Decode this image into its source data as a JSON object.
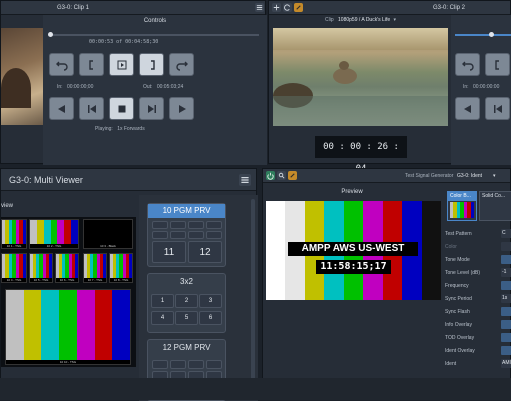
{
  "clip1": {
    "title": "G3-0: Clip 1",
    "controls_title": "Controls",
    "timecode": "00:00:53 of 00:04:58;30",
    "in_label": "In:",
    "in_value": "00:00:00;00",
    "out_label": "Out:",
    "out_value": "00:05:03;24",
    "playing_label": "Playing:",
    "playing_value": "1x Forwards"
  },
  "clip2": {
    "title": "G3-0: Clip 2",
    "clip_label": "Clip",
    "clip_value": "1080p59 / A Duck's Life",
    "timecode_big": "00 : 00 : 26 : 04",
    "in_label": "In:",
    "in_value": "00:00:00:00"
  },
  "multiviewer": {
    "title": "G3-0: Multi Viewer",
    "preview_label": "view",
    "layout1": {
      "title": "10 PGM PRV",
      "cells": [
        "",
        "",
        "",
        "",
        "",
        "",
        "",
        "",
        "",
        "11",
        "12"
      ]
    },
    "layout2": {
      "title": "3x2",
      "cells": [
        "1",
        "2",
        "3",
        "4",
        "5",
        "6"
      ]
    },
    "layout3": {
      "title": "12 PGM PRV"
    },
    "thumb_labels": [
      "10 1 - TSG",
      "10 2 - TSG",
      "10 3 - Black",
      "10 4 - TSG",
      "10 5 - TSG",
      "10 6 - TSG",
      "10 7 - TSG",
      "10 8 - TSG",
      "10 9 - TSG",
      "10 10 - TSG"
    ]
  },
  "tsg": {
    "gen_label": "Test Signal Generator",
    "gen_value": "G3-0: Ident",
    "preview_title": "Preview",
    "overlay_line1": "AMPP AWS US-WEST",
    "overlay_line2": "11:58:15;17",
    "tile1": "Color B...",
    "tile2": "Solid Co...",
    "properties": [
      "Test Pattern",
      "Color",
      "Tone Mode",
      "Tone Level (dB)",
      "Frequency",
      "Sync Period",
      "Sync Flash",
      "Info Overlay",
      "TOD Overlay",
      "Ident Overlay",
      "Ident"
    ],
    "values": [
      "C",
      "",
      "",
      "-1",
      "",
      "1s",
      "",
      "",
      "",
      "",
      "AMI"
    ]
  },
  "colors": {
    "accent_blue": "#4a86c8",
    "panel": "#262d37",
    "header": "#2e3641"
  },
  "chart_data": {
    "type": "table",
    "bars_seven": [
      "#c0c0c0",
      "#c0c000",
      "#00c0c0",
      "#00c000",
      "#c000c0",
      "#c00000",
      "#0000c0"
    ]
  }
}
